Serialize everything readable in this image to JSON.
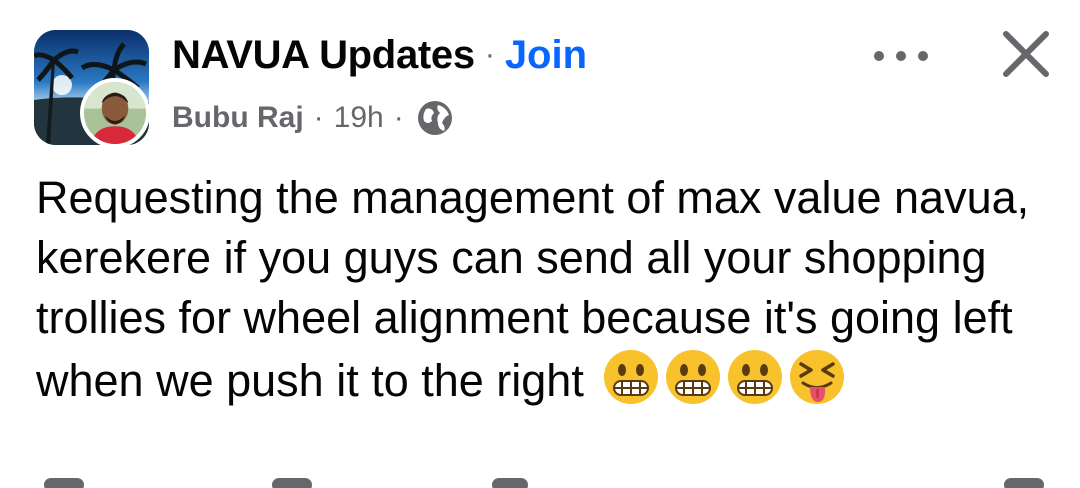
{
  "header": {
    "group_name": "NAVUA Updates",
    "separator": "·",
    "join_label": "Join",
    "author": "Bubu Raj",
    "time": "19h",
    "privacy_icon": "globe-icon",
    "more_icon": "more-options-icon",
    "close_icon": "close-icon"
  },
  "post": {
    "text": "Requesting the management of max value navua, kerekere if you guys can send all your shopping trollies for wheel alignment because it's going left when we push it to the right",
    "emojis": [
      "grimacing-face",
      "grimacing-face",
      "grimacing-face",
      "squinting-face-with-tongue"
    ]
  },
  "colors": {
    "link": "#0866ff",
    "secondary_text": "#65676b",
    "primary_text": "#050505"
  }
}
